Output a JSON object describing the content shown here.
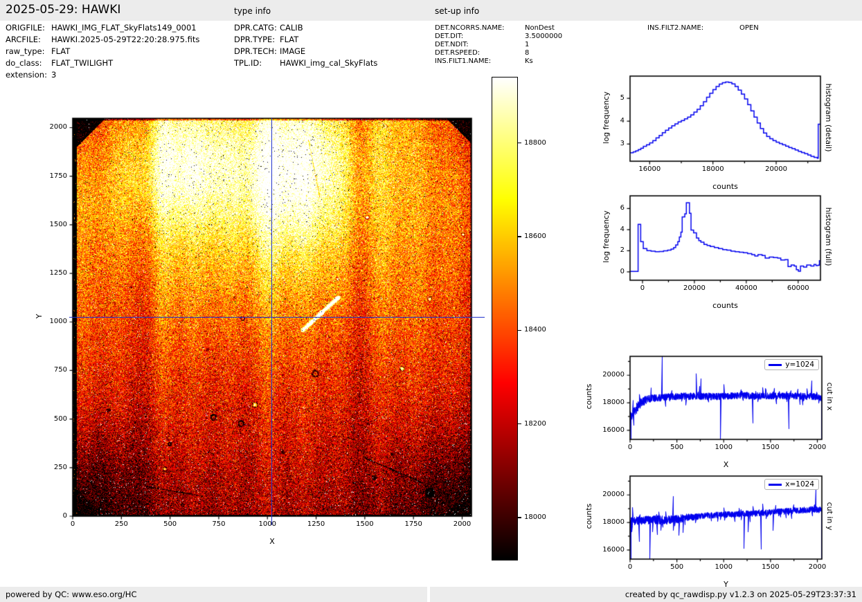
{
  "header": {
    "title": "2025-05-29: HAWKI",
    "type_info_label": "type info",
    "setup_info_label": "set-up info",
    "file_info": [
      {
        "label": "ORIGFILE:",
        "value": "HAWKI_IMG_FLAT_SkyFlats149_0001"
      },
      {
        "label": "ARCFILE:",
        "value": "HAWKI.2025-05-29T22:20:28.975.fits"
      },
      {
        "label": "raw_type:",
        "value": "FLAT"
      },
      {
        "label": "do_class:",
        "value": "FLAT_TWILIGHT"
      },
      {
        "label": "extension:",
        "value": "3"
      }
    ],
    "type_info": [
      {
        "label": "DPR.CATG:",
        "value": "CALIB"
      },
      {
        "label": "DPR.TYPE:",
        "value": "FLAT"
      },
      {
        "label": "DPR.TECH:",
        "value": "IMAGE"
      },
      {
        "label": "TPL.ID:",
        "value": "HAWKI_img_cal_SkyFlats"
      }
    ],
    "setup_info": [
      {
        "label": "DET.NCORRS.NAME:",
        "value": "NonDest"
      },
      {
        "label": "DET.DIT:",
        "value": "3.5000000"
      },
      {
        "label": "DET.NDIT:",
        "value": "1"
      },
      {
        "label": "DET.RSPEED:",
        "value": "8"
      },
      {
        "label": "INS.FILT1.NAME:",
        "value": "Ks"
      }
    ],
    "setup_info_col2": [
      {
        "label": "INS.FILT2.NAME:",
        "value": "OPEN"
      }
    ]
  },
  "footer": {
    "left": "powered by QC: www.eso.org/HC",
    "right": "created by qc_rawdisp.py v1.2.3 on 2025-05-29T23:37:31"
  },
  "colors": {
    "line_blue": "#0000ee",
    "crosshair_blue": "#2233cc",
    "bar_bg": "#ececec",
    "legend_border": "#b3b3b3"
  },
  "chart_data": [
    {
      "id": "main_image",
      "type": "heatmap",
      "xlabel": "X",
      "ylabel": "Y",
      "xlim": [
        0,
        2048
      ],
      "ylim": [
        0,
        2048
      ],
      "xticks": [
        0,
        250,
        500,
        750,
        1000,
        1250,
        1500,
        1750,
        2000
      ],
      "yticks": [
        0,
        250,
        500,
        750,
        1000,
        1250,
        1500,
        1750,
        2000
      ],
      "colormap": "hot",
      "value_range": [
        17910,
        18940
      ],
      "colorbar": {
        "ticks": [
          18000,
          18200,
          18400,
          18600,
          18800
        ]
      },
      "crosshair": {
        "x": 1024,
        "y": 1024
      },
      "content": "2048x2048 HAWKI raw twilight sky-flat: noisy mottled field ~18400 counts, brighter (~18900, near white) toward top-centre, dark detector edges/corners, vertical sensitivity stripes, dust donuts and a bright white scratch right of centre",
      "features": {
        "base_level": 18280,
        "top_gradient": 250,
        "bright_regions": [
          [
            560,
            1810,
            330,
            330,
            380
          ],
          [
            1150,
            1800,
            300,
            380,
            430
          ],
          [
            1000,
            1450,
            650,
            500,
            180
          ]
        ],
        "dark_corners": [
          [
            0,
            0,
            420,
            260
          ],
          [
            2048,
            0,
            420,
            260
          ],
          [
            0,
            2048,
            300,
            200
          ],
          [
            2048,
            2048,
            240,
            170
          ]
        ],
        "stripes": [
          [
            470,
            60,
            160
          ],
          [
            1000,
            70,
            150
          ],
          [
            1600,
            80,
            90
          ],
          [
            390,
            50,
            -110
          ],
          [
            1480,
            60,
            -90
          ]
        ],
        "dark_spots": [
          [
            185,
            545,
            12,
            0
          ],
          [
            320,
            484,
            8,
            0
          ],
          [
            723,
            509,
            13,
            5
          ],
          [
            865,
            477,
            13,
            4
          ],
          [
            1247,
            734,
            15,
            5
          ],
          [
            694,
            858,
            9,
            0
          ],
          [
            1549,
            199,
            13,
            0
          ],
          [
            1834,
            121,
            26,
            0
          ],
          [
            873,
            1018,
            9,
            4
          ],
          [
            1080,
            330,
            10,
            0
          ],
          [
            640,
            1490,
            7,
            0
          ],
          [
            1200,
            1650,
            6,
            0
          ],
          [
            498,
            370,
            7,
            4
          ],
          [
            300,
            1180,
            7,
            0
          ],
          [
            1640,
            320,
            9,
            0
          ]
        ],
        "bright_donuts": [
          [
            474,
            242,
            9
          ],
          [
            936,
            573,
            12
          ],
          [
            1692,
            759,
            10
          ],
          [
            1834,
            1118,
            9
          ],
          [
            1513,
            1538,
            8
          ],
          [
            1360,
            1220,
            6
          ],
          [
            2005,
            1450,
            7
          ]
        ],
        "streak": [
          [
            1183,
            958
          ],
          [
            1280,
            1048
          ],
          [
            1364,
            1125
          ]
        ],
        "cracks": [
          [
            [
              1211,
              1935
            ],
            [
              1247,
              1752
            ],
            [
              1270,
              1640
            ]
          ],
          [
            [
              381,
              153
            ],
            [
              666,
              103
            ]
          ],
          [
            [
              1500,
              300
            ],
            [
              1790,
              175
            ]
          ]
        ]
      }
    },
    {
      "id": "hist_detail",
      "type": "line",
      "step": true,
      "xlabel": "counts",
      "ylabel": "log frequency",
      "right_label": "histogram (detail)",
      "xlim": [
        15380,
        21400
      ],
      "ylim": [
        2.25,
        5.97
      ],
      "xticks": [
        16000,
        18000,
        20000
      ],
      "minor_xticks": [
        17000,
        19000,
        21000
      ],
      "yticks": [
        3,
        4,
        5
      ],
      "points": [
        [
          15380,
          2.62
        ],
        [
          15480,
          2.66
        ],
        [
          15560,
          2.7
        ],
        [
          15640,
          2.76
        ],
        [
          15720,
          2.82
        ],
        [
          15800,
          2.9
        ],
        [
          15900,
          2.97
        ],
        [
          16000,
          3.05
        ],
        [
          16100,
          3.15
        ],
        [
          16200,
          3.27
        ],
        [
          16300,
          3.38
        ],
        [
          16400,
          3.5
        ],
        [
          16500,
          3.6
        ],
        [
          16600,
          3.7
        ],
        [
          16700,
          3.8
        ],
        [
          16800,
          3.88
        ],
        [
          16900,
          3.97
        ],
        [
          17000,
          4.03
        ],
        [
          17100,
          4.1
        ],
        [
          17200,
          4.18
        ],
        [
          17300,
          4.28
        ],
        [
          17400,
          4.4
        ],
        [
          17500,
          4.52
        ],
        [
          17600,
          4.68
        ],
        [
          17700,
          4.85
        ],
        [
          17800,
          5.05
        ],
        [
          17900,
          5.22
        ],
        [
          18000,
          5.38
        ],
        [
          18100,
          5.52
        ],
        [
          18200,
          5.62
        ],
        [
          18300,
          5.68
        ],
        [
          18400,
          5.71
        ],
        [
          18500,
          5.69
        ],
        [
          18600,
          5.63
        ],
        [
          18700,
          5.52
        ],
        [
          18800,
          5.36
        ],
        [
          18900,
          5.18
        ],
        [
          19000,
          4.97
        ],
        [
          19100,
          4.72
        ],
        [
          19200,
          4.45
        ],
        [
          19300,
          4.18
        ],
        [
          19400,
          3.92
        ],
        [
          19500,
          3.68
        ],
        [
          19600,
          3.48
        ],
        [
          19700,
          3.33
        ],
        [
          19800,
          3.23
        ],
        [
          19900,
          3.15
        ],
        [
          20000,
          3.08
        ],
        [
          20100,
          3.02
        ],
        [
          20200,
          2.97
        ],
        [
          20300,
          2.91
        ],
        [
          20400,
          2.85
        ],
        [
          20500,
          2.8
        ],
        [
          20600,
          2.74
        ],
        [
          20700,
          2.68
        ],
        [
          20800,
          2.63
        ],
        [
          20900,
          2.58
        ],
        [
          21000,
          2.52
        ],
        [
          21100,
          2.46
        ],
        [
          21200,
          2.42
        ],
        [
          21300,
          2.38
        ],
        [
          21330,
          3.87
        ]
      ]
    },
    {
      "id": "hist_full",
      "type": "line",
      "step": true,
      "xlabel": "counts",
      "ylabel": "log frequency",
      "right_label": "histogram (full)",
      "xlim": [
        -4800,
        68600
      ],
      "ylim": [
        -0.8,
        7.2
      ],
      "xticks": [
        0,
        20000,
        40000,
        60000
      ],
      "minor_xticks": [
        10000,
        30000,
        50000
      ],
      "yticks": [
        0,
        2,
        4,
        6
      ],
      "points": [
        [
          -4800,
          0.03
        ],
        [
          -2600,
          0.03
        ],
        [
          -1700,
          4.5
        ],
        [
          -700,
          2.85
        ],
        [
          300,
          2.2
        ],
        [
          1700,
          2.0
        ],
        [
          3300,
          1.95
        ],
        [
          4900,
          1.9
        ],
        [
          6500,
          1.92
        ],
        [
          8100,
          1.98
        ],
        [
          9700,
          2.05
        ],
        [
          11000,
          2.15
        ],
        [
          12000,
          2.3
        ],
        [
          12800,
          2.55
        ],
        [
          13600,
          2.85
        ],
        [
          14200,
          3.3
        ],
        [
          14800,
          3.75
        ],
        [
          15300,
          5.2
        ],
        [
          16300,
          5.5
        ],
        [
          16900,
          6.55
        ],
        [
          18100,
          5.55
        ],
        [
          18700,
          3.95
        ],
        [
          19700,
          3.7
        ],
        [
          20800,
          3.2
        ],
        [
          21700,
          2.95
        ],
        [
          22500,
          2.8
        ],
        [
          23700,
          2.6
        ],
        [
          24900,
          2.5
        ],
        [
          26100,
          2.4
        ],
        [
          27700,
          2.3
        ],
        [
          29300,
          2.2
        ],
        [
          30900,
          2.1
        ],
        [
          32500,
          2.05
        ],
        [
          34100,
          1.95
        ],
        [
          35700,
          1.9
        ],
        [
          37300,
          1.85
        ],
        [
          38900,
          1.8
        ],
        [
          40500,
          1.72
        ],
        [
          42100,
          1.62
        ],
        [
          43300,
          1.5
        ],
        [
          44500,
          1.62
        ],
        [
          46100,
          1.55
        ],
        [
          47300,
          1.3
        ],
        [
          48900,
          1.4
        ],
        [
          50500,
          1.35
        ],
        [
          52100,
          1.3
        ],
        [
          53300,
          1.12
        ],
        [
          54900,
          1.15
        ],
        [
          56100,
          0.5
        ],
        [
          57300,
          0.65
        ],
        [
          58500,
          0.55
        ],
        [
          59300,
          0.2
        ],
        [
          60100,
          0.05
        ],
        [
          60900,
          0.55
        ],
        [
          62100,
          0.45
        ],
        [
          63300,
          0.65
        ],
        [
          64900,
          0.55
        ],
        [
          66100,
          0.7
        ],
        [
          66900,
          0.6
        ],
        [
          67700,
          0.62
        ],
        [
          68200,
          1.05
        ]
      ]
    },
    {
      "id": "cut_x",
      "type": "line",
      "xlabel": "X",
      "ylabel": "counts",
      "right_label": "cut in x",
      "legend": "y=1024",
      "xlim": [
        0,
        2048
      ],
      "ylim": [
        15340,
        21370
      ],
      "xticks": [
        0,
        500,
        1000,
        1500,
        2000
      ],
      "minor_xticks": [
        250,
        750,
        1250,
        1750
      ],
      "yticks": [
        16000,
        18000,
        20000
      ],
      "minor_yticks": [
        17000,
        19000,
        21000
      ],
      "envelope": [
        [
          0,
          17050
        ],
        [
          40,
          17350
        ],
        [
          100,
          17900
        ],
        [
          180,
          18250
        ],
        [
          350,
          18400
        ],
        [
          600,
          18480
        ],
        [
          900,
          18450
        ],
        [
          1200,
          18520
        ],
        [
          1500,
          18480
        ],
        [
          1800,
          18500
        ],
        [
          2000,
          18430
        ],
        [
          2048,
          18250
        ]
      ],
      "noise_amp": [
        [
          0,
          420
        ],
        [
          150,
          330
        ],
        [
          350,
          260
        ],
        [
          2048,
          255
        ]
      ],
      "spikes": [
        [
          4,
          15340
        ],
        [
          35,
          16350
        ],
        [
          340,
          21370
        ],
        [
          700,
          20120
        ],
        [
          755,
          19750
        ],
        [
          962,
          15340
        ],
        [
          1310,
          16520
        ],
        [
          1692,
          16100
        ],
        [
          1940,
          19600
        ],
        [
          2042,
          15340
        ]
      ]
    },
    {
      "id": "cut_y",
      "type": "line",
      "xlabel": "Y",
      "ylabel": "counts",
      "right_label": "cut in y",
      "legend": "x=1024",
      "xlim": [
        0,
        2048
      ],
      "ylim": [
        15340,
        21370
      ],
      "xticks": [
        0,
        500,
        1000,
        1500,
        2000
      ],
      "minor_xticks": [
        250,
        750,
        1250,
        1750
      ],
      "yticks": [
        16000,
        18000,
        20000
      ],
      "minor_yticks": [
        17000,
        19000,
        21000
      ],
      "envelope": [
        [
          0,
          18080
        ],
        [
          150,
          18180
        ],
        [
          400,
          18180
        ],
        [
          600,
          18320
        ],
        [
          800,
          18500
        ],
        [
          1000,
          18570
        ],
        [
          1200,
          18620
        ],
        [
          1400,
          18680
        ],
        [
          1600,
          18780
        ],
        [
          1800,
          18880
        ],
        [
          1950,
          18950
        ],
        [
          2048,
          18900
        ]
      ],
      "noise_amp": [
        [
          0,
          340
        ],
        [
          550,
          300
        ],
        [
          700,
          230
        ],
        [
          2048,
          230
        ]
      ],
      "spikes": [
        [
          6,
          15340
        ],
        [
          95,
          16600
        ],
        [
          210,
          15340
        ],
        [
          290,
          17100
        ],
        [
          462,
          19900
        ],
        [
          515,
          17050
        ],
        [
          560,
          17250
        ],
        [
          1212,
          16100
        ],
        [
          1260,
          17300
        ],
        [
          1400,
          16050
        ],
        [
          1522,
          17400
        ],
        [
          1978,
          20480
        ],
        [
          2044,
          15340
        ]
      ]
    }
  ]
}
